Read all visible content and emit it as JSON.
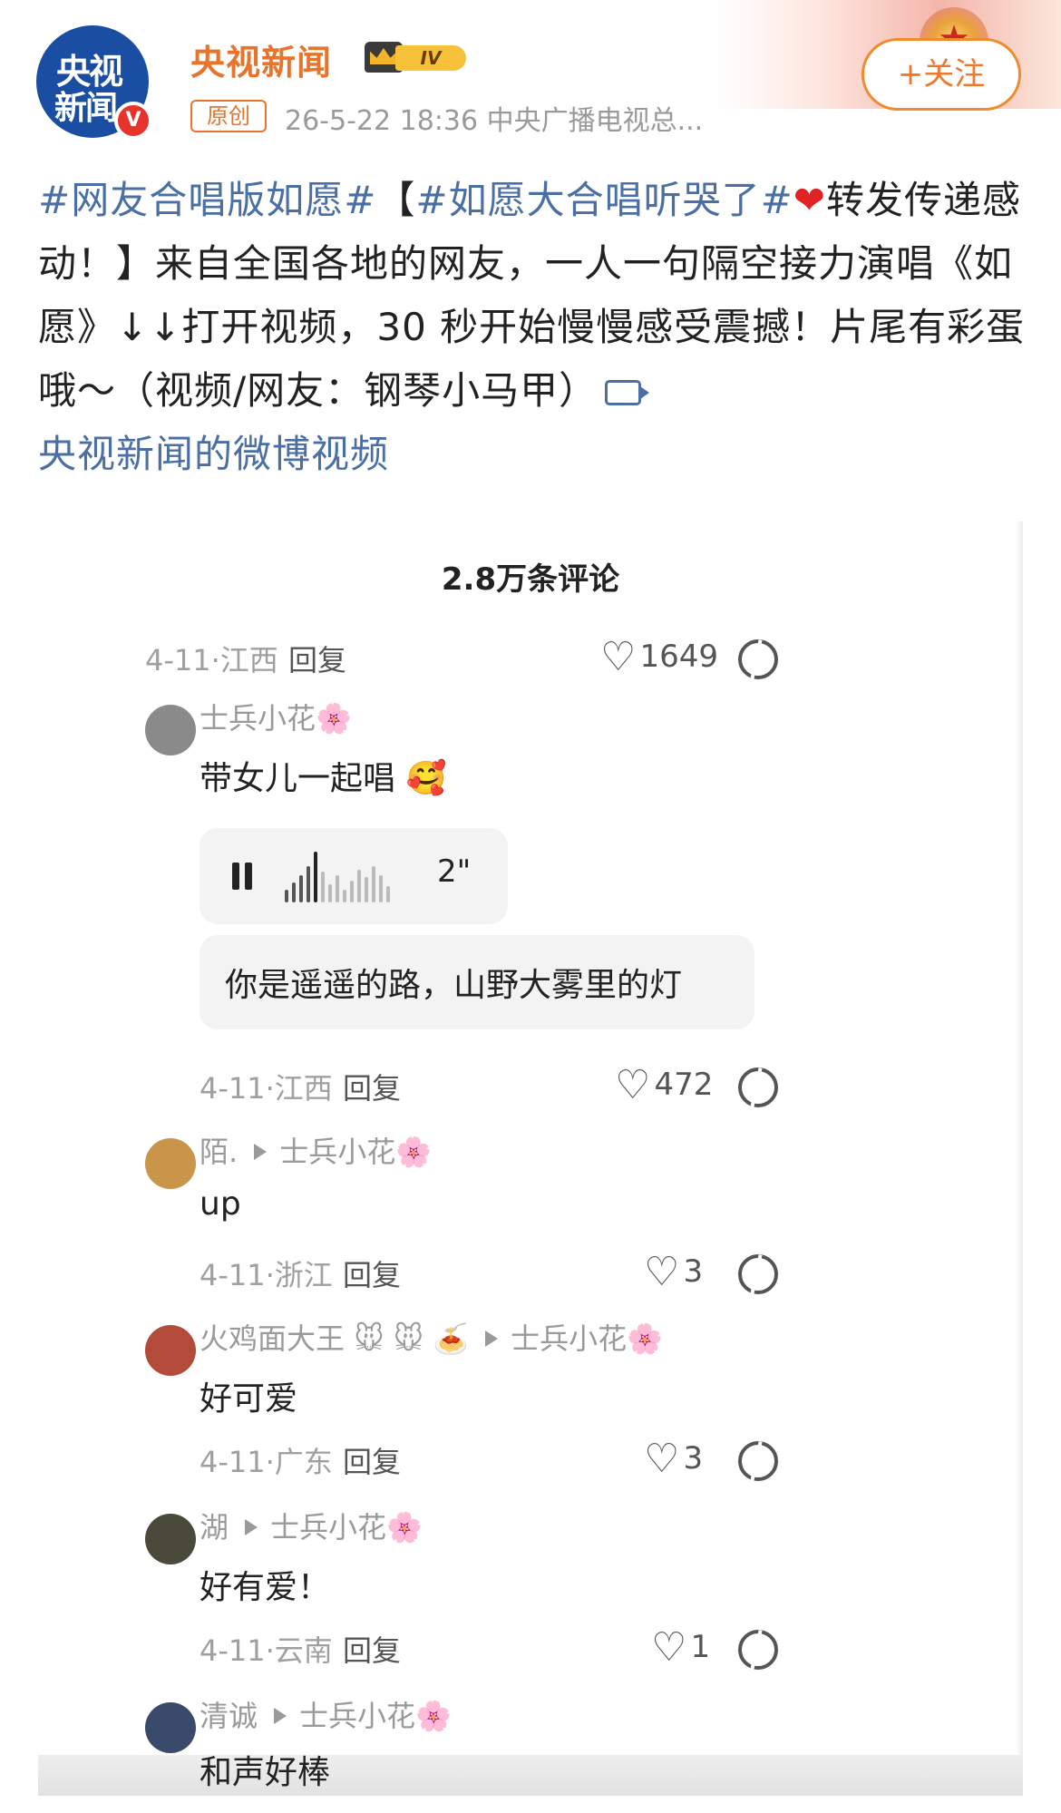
{
  "account": {
    "avatar_line1": "央视",
    "avatar_line2": "新闻",
    "verified_badge": "V",
    "name": "央视新闻",
    "rank_label": "IV",
    "origin_badge": "原创",
    "meta": "26-5-22 18:36 中央广播电视总...",
    "follow_label": "+关注"
  },
  "post": {
    "tag1": "#网友合唱版如愿#",
    "bracket_open": "【",
    "tag2": "#如愿大合唱听哭了#",
    "heart": "❤",
    "text": "转发传递感动！】来自全国各地的网友，一人一句隔空接力演唱《如愿》↓↓打开视频，30 秒开始慢慢感受震撼！片尾有彩蛋哦～（视频/网友：钢琴小马甲）",
    "video_link": "央视新闻的微博视频"
  },
  "comments_panel": {
    "count_title": "2.8万条评论",
    "reply_label": "回复",
    "top_row": {
      "meta": "4-11·江西",
      "likes": "1649"
    },
    "comments": [
      {
        "user": "士兵小花",
        "reply_to": "",
        "flower": "🌸",
        "text": "带女儿一起唱",
        "emoji": "🥰",
        "voice_duration": "2\"",
        "transcript": "你是遥遥的路，山野大雾里的灯",
        "meta": "4-11·江西",
        "likes": "472",
        "avatar_color": "#8a8a8a"
      },
      {
        "user": "陌.",
        "reply_to": "士兵小花",
        "flower": "🌸",
        "text": "up",
        "meta": "4-11·浙江",
        "likes": "3",
        "avatar_color": "#c8954a"
      },
      {
        "user": "火鸡面大王",
        "user_emoji": "🐭 🐭 🍝",
        "reply_to": "士兵小花",
        "flower": "🌸",
        "text": "好可爱",
        "meta": "4-11·广东",
        "likes": "3",
        "avatar_color": "#b34a3a"
      },
      {
        "user": "湖",
        "reply_to": "士兵小花",
        "flower": "🌸",
        "text": "好有爱！",
        "meta": "4-11·云南",
        "likes": "1",
        "avatar_color": "#4a4a3a"
      },
      {
        "user": "清诚",
        "reply_to": "士兵小花",
        "flower": "🌸",
        "text": "和声好棒",
        "avatar_color": "#3a4a6a"
      }
    ]
  },
  "colors": {
    "brand_orange": "#e8742c",
    "link_blue": "#4a6fa5",
    "avatar_blue": "#1a4ea2",
    "verified_red": "#e8322c"
  },
  "icons": [
    "crown-icon",
    "verified-icon",
    "video-link-icon",
    "heart-icon",
    "broken-heart-icon",
    "pause-icon",
    "waveform-icon",
    "flower-icon",
    "reply-arrow-icon"
  ]
}
